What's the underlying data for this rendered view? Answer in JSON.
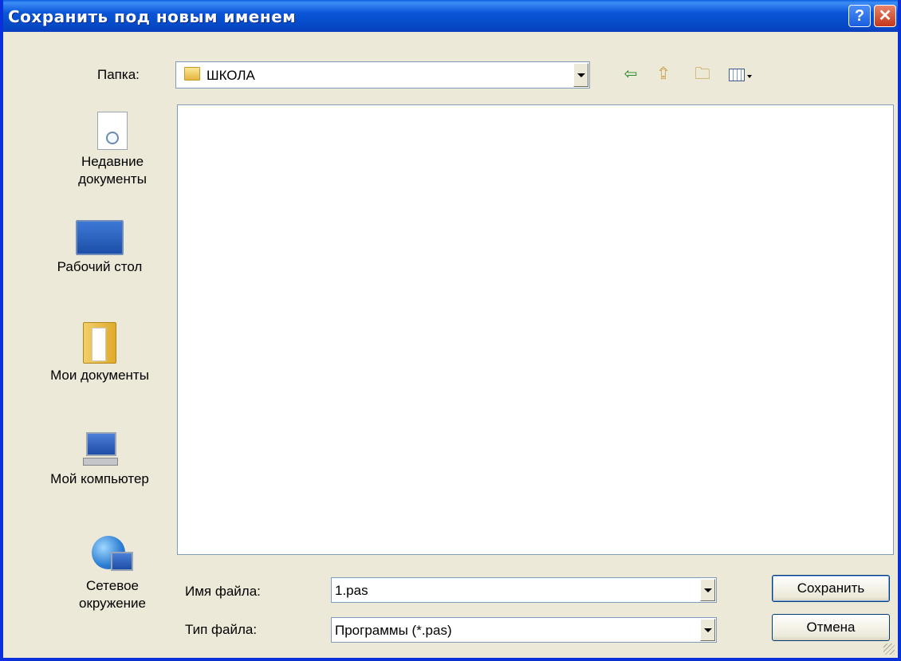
{
  "window": {
    "title": "Сохранить под новым именем",
    "help_symbol": "?",
    "close_symbol": "✕"
  },
  "folder_bar": {
    "label": "Папка:",
    "selected": "ШКОЛА",
    "icons": [
      "back-arrow-icon",
      "up-folder-icon",
      "new-folder-icon",
      "view-menu-icon"
    ]
  },
  "places": [
    {
      "label": "Недавние документы",
      "icon": "recent-documents-icon"
    },
    {
      "label": "Рабочий стол",
      "icon": "desktop-icon"
    },
    {
      "label": "Мои документы",
      "icon": "my-documents-icon"
    },
    {
      "label": "Мой компьютер",
      "icon": "my-computer-icon"
    },
    {
      "label": "Сетевое окружение",
      "icon": "network-icon"
    }
  ],
  "filename": {
    "label": "Имя файла:",
    "value": "1.pas"
  },
  "filetype": {
    "label": "Тип файла:",
    "value": "Программы (*.pas)"
  },
  "buttons": {
    "save": "Сохранить",
    "cancel": "Отмена"
  },
  "colors": {
    "titlebar": "#0a56d8",
    "window_bg": "#ece9d8",
    "close_button": "#c4371b"
  }
}
